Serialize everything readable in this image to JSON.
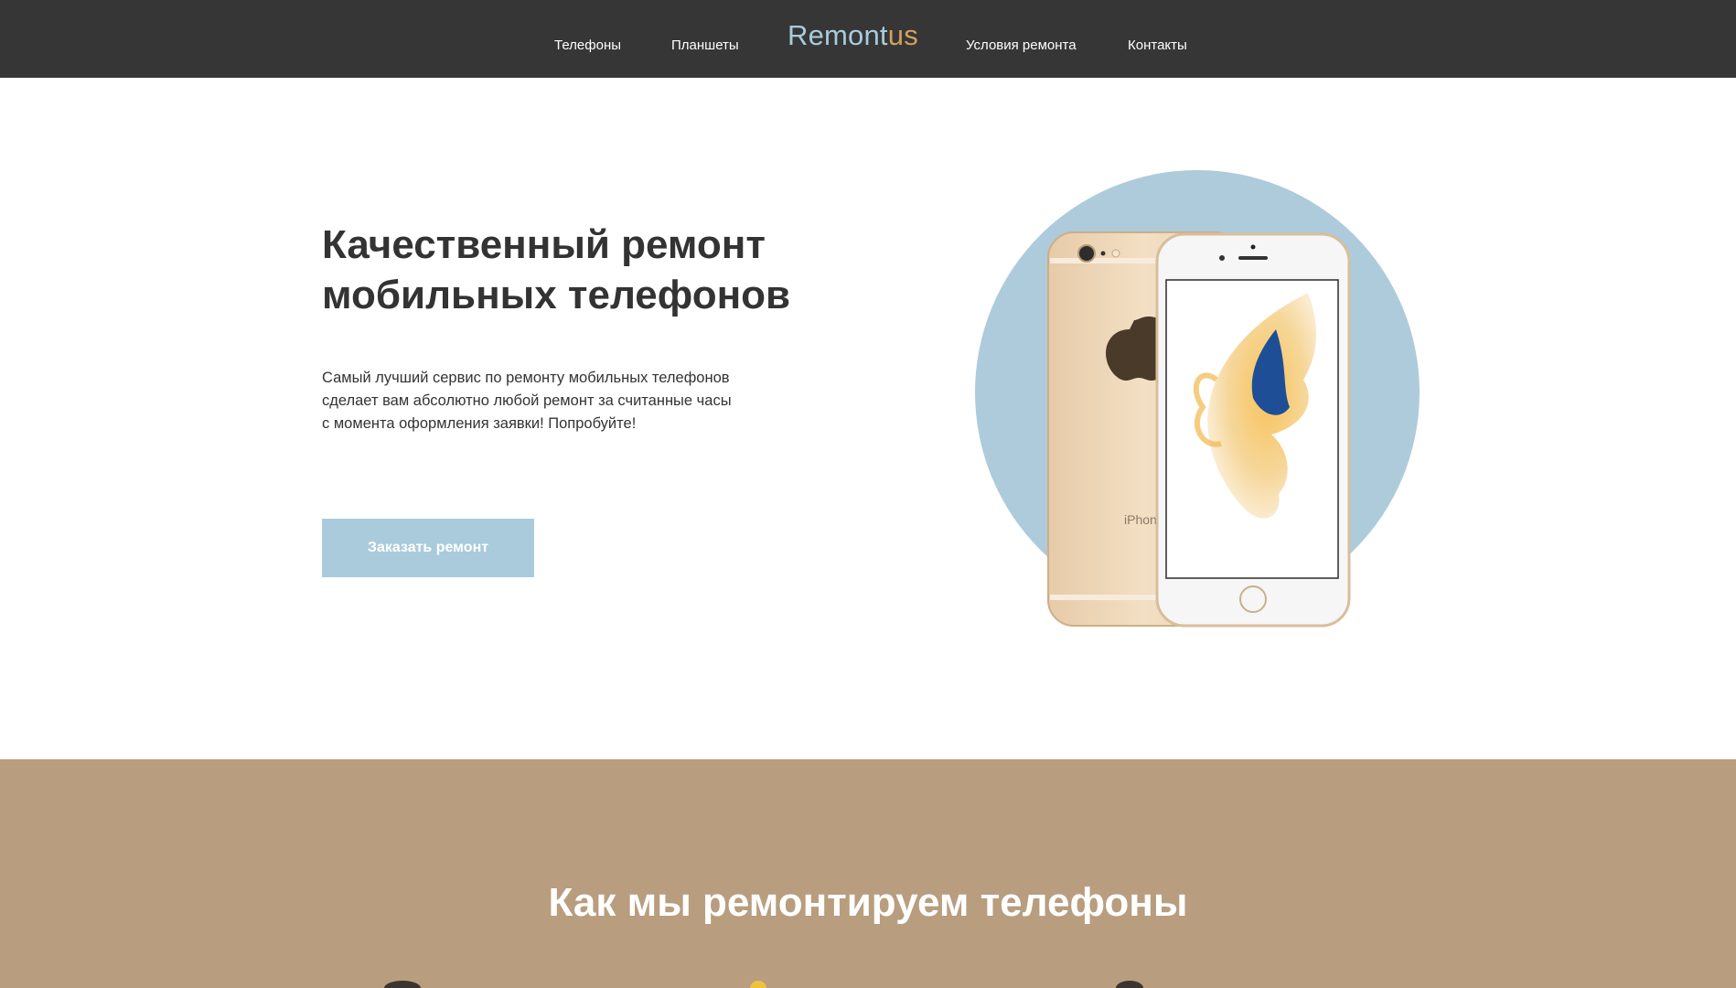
{
  "header": {
    "nav_left": [
      {
        "label": "Телефоны"
      },
      {
        "label": "Планшеты"
      }
    ],
    "logo": {
      "part1": "Remont",
      "part2": "us"
    },
    "nav_right": [
      {
        "label": "Условия ремонта"
      },
      {
        "label": "Контакты"
      }
    ]
  },
  "hero": {
    "title_lines": [
      "Качественный ремонт",
      "мобильных телефонов"
    ],
    "text_lines": [
      "Самый лучший сервис по ремонту мобильных телефонов",
      "сделает вам абсолютно любой ремонт за считанные часы",
      "с момента оформления заявки! Попробуйте!"
    ],
    "button_label": "Заказать ремонт",
    "phone_back_text": "iPhone"
  },
  "section2": {
    "title": "Как мы ремонтируем телефоны"
  },
  "colors": {
    "header_bg": "#363636",
    "accent_blue": "#a9cbdc",
    "accent_gold": "#d1a05e",
    "section_brown": "#b89d7e"
  }
}
